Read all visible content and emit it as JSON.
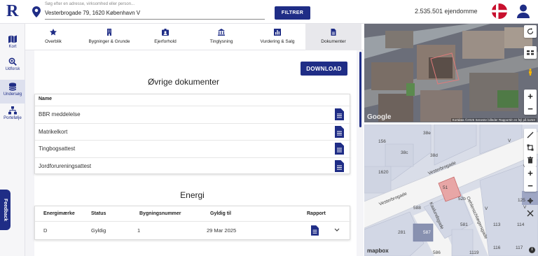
{
  "header": {
    "logo": "R",
    "search_placeholder": "Søg efter en adresse, virksomhed eller person...",
    "search_value": "Vesterbrogade 79, 1620 København V",
    "filter_label": "FILTRER",
    "property_count": "2.535.501 ejendomme"
  },
  "rail": {
    "items": [
      {
        "label": "Kort",
        "icon": "map-icon"
      },
      {
        "label": "Udforsk",
        "icon": "explore-icon"
      },
      {
        "label": "Undersøg",
        "icon": "database-icon"
      },
      {
        "label": "Portefølje",
        "icon": "portfolio-icon"
      }
    ],
    "feedback": "Feedback"
  },
  "tabs": [
    {
      "label": "Overblik",
      "icon": "star-icon"
    },
    {
      "label": "Bygninger & Grunde",
      "icon": "building-icon"
    },
    {
      "label": "Ejerforhold",
      "icon": "owner-icon"
    },
    {
      "label": "Tinglysning",
      "icon": "courthouse-icon"
    },
    {
      "label": "Vurdering & Salg",
      "icon": "bar-chart-icon"
    },
    {
      "label": "Dokumenter",
      "icon": "document-icon"
    }
  ],
  "documents": {
    "download_label": "DOWNLOAD",
    "title": "Øvrige dokumenter",
    "column_header": "Name",
    "items": [
      "BBR meddelelse",
      "Matrikelkort",
      "Tingbogsattest",
      "Jordforureningsattest"
    ]
  },
  "energy": {
    "title": "Energi",
    "headers": [
      "Energimærke",
      "Status",
      "Bygningsnummer",
      "Gyldig til",
      "Rapport"
    ],
    "row": [
      "D",
      "Gyldig",
      "1",
      "29 Mar 2025"
    ]
  },
  "aerial": {
    "logo": "Google",
    "credit": "Kortdata ©2025  Seneste billeder  Rapportér en fejl på kortet"
  },
  "map": {
    "street_name": "Vesterbrogade",
    "street_name_2": "Vesterbrogade",
    "side_street": "Kaalundsgade",
    "side_street_2": "Oehlenschlægersgade",
    "logo": "mapbox",
    "info": "i",
    "parcel_labels": [
      "38e",
      "156",
      "38c",
      "38d",
      "1620",
      "51",
      "52b",
      "588",
      "587",
      "281",
      "581",
      "113",
      "114",
      "116",
      "117",
      "125",
      "V",
      "V",
      "V",
      "V",
      "V",
      "586",
      "1119"
    ]
  },
  "colors": {
    "brand": "#1f2d86",
    "highlight_parcel": "#e8a6a6"
  }
}
